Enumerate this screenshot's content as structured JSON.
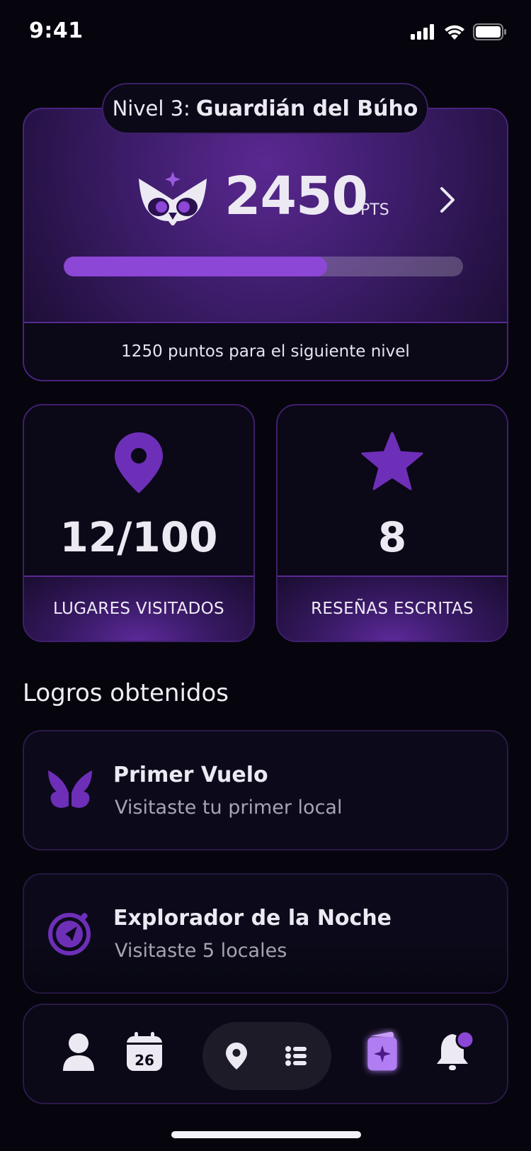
{
  "status": {
    "time": "9:41"
  },
  "level": {
    "prefix": "Nivel 3:",
    "name": "Guardián del Búho",
    "points": "2450",
    "points_unit": "PTS",
    "progress_fraction": 0.66,
    "next_level_text": "1250 puntos para el siguiente nivel"
  },
  "stats": [
    {
      "icon": "location-pin-icon",
      "value": "12/100",
      "label": "LUGARES VISITADOS"
    },
    {
      "icon": "star-icon",
      "value": "8",
      "label": "RESEÑAS ESCRITAS"
    }
  ],
  "achievements": {
    "title": "Logros obtenidos",
    "items": [
      {
        "icon": "wings-icon",
        "title": "Primer Vuelo",
        "description": "Visitaste tu primer local"
      },
      {
        "icon": "compass-icon",
        "title": "Explorador de la Noche",
        "description": "Visitaste 5 locales"
      }
    ]
  },
  "nav": {
    "calendar_day": "26",
    "items": [
      "profile-icon",
      "calendar-icon",
      "map-pin-icon",
      "list-icon",
      "rewards-card-icon",
      "notification-bell-icon"
    ],
    "active": "rewards-card-icon"
  },
  "colors": {
    "accent": "#8c47d6",
    "icon_purple": "#6d2fb8",
    "background": "#06050d",
    "card": "#0b0817"
  }
}
